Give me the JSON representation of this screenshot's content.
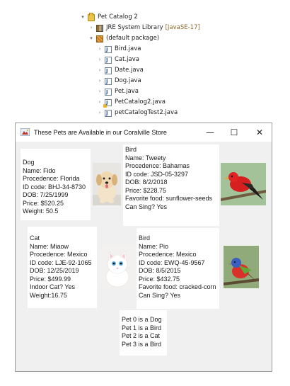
{
  "tree": {
    "project": "Pet Catalog 2",
    "library_name": "JRE System Library",
    "library_tag": "[JavaSE-17]",
    "package": "(default package)",
    "files": [
      "Bird.java",
      "Cat.java",
      "Date.java",
      "Dog.java",
      "Pet.java",
      "PetCatalog2.java",
      "petCatalogTest2.java"
    ]
  },
  "window": {
    "title": "These Pets are Available in our Coralville Store",
    "minimize": "—",
    "maximize": "☐",
    "close": "✕"
  },
  "pets": {
    "dog": {
      "species": "Dog",
      "name": "Name: Fido",
      "procedence": "Procedence: Florida",
      "id": "ID code: BHJ-34-8730",
      "dob": "DOB: 7/25/1999",
      "price": "Price: $520.25",
      "extra": "Weight: 50.5"
    },
    "bird1": {
      "species": "Bird",
      "name": "Name: Tweety",
      "procedence": "Procedence: Bahamas",
      "id": "ID code: JSD-05-3297",
      "dob": "DOB: 8/2/2018",
      "price": "Price: $228.75",
      "food": "Favorite food: sunflower-seeds",
      "sing": "Can Sing? Yes"
    },
    "cat": {
      "species": "Cat",
      "name": "Name: Miaow",
      "procedence": "Procedence: Mexico",
      "id": "ID code: LJE-92-1065",
      "dob": "DOB: 12/25/2019",
      "price": "Price: $499.99",
      "indoor": "Indoor Cat? Yes",
      "weight": "Weight:16.75"
    },
    "bird2": {
      "species": "Bird",
      "name": "Name: Pio",
      "procedence": "Procedence: Mexico",
      "id": "ID code: EWQ-45-9567",
      "dob": "DOB: 8/5/2015",
      "price": "Price: $432.75",
      "food": "Favorite food: cracked-corn",
      "sing": "Can Sing? Yes"
    }
  },
  "summary": [
    "Pet 0 is a Dog",
    "Pet 1 is a Bird",
    "Pet 2 is a Cat",
    "Pet 3 is a Bird"
  ]
}
